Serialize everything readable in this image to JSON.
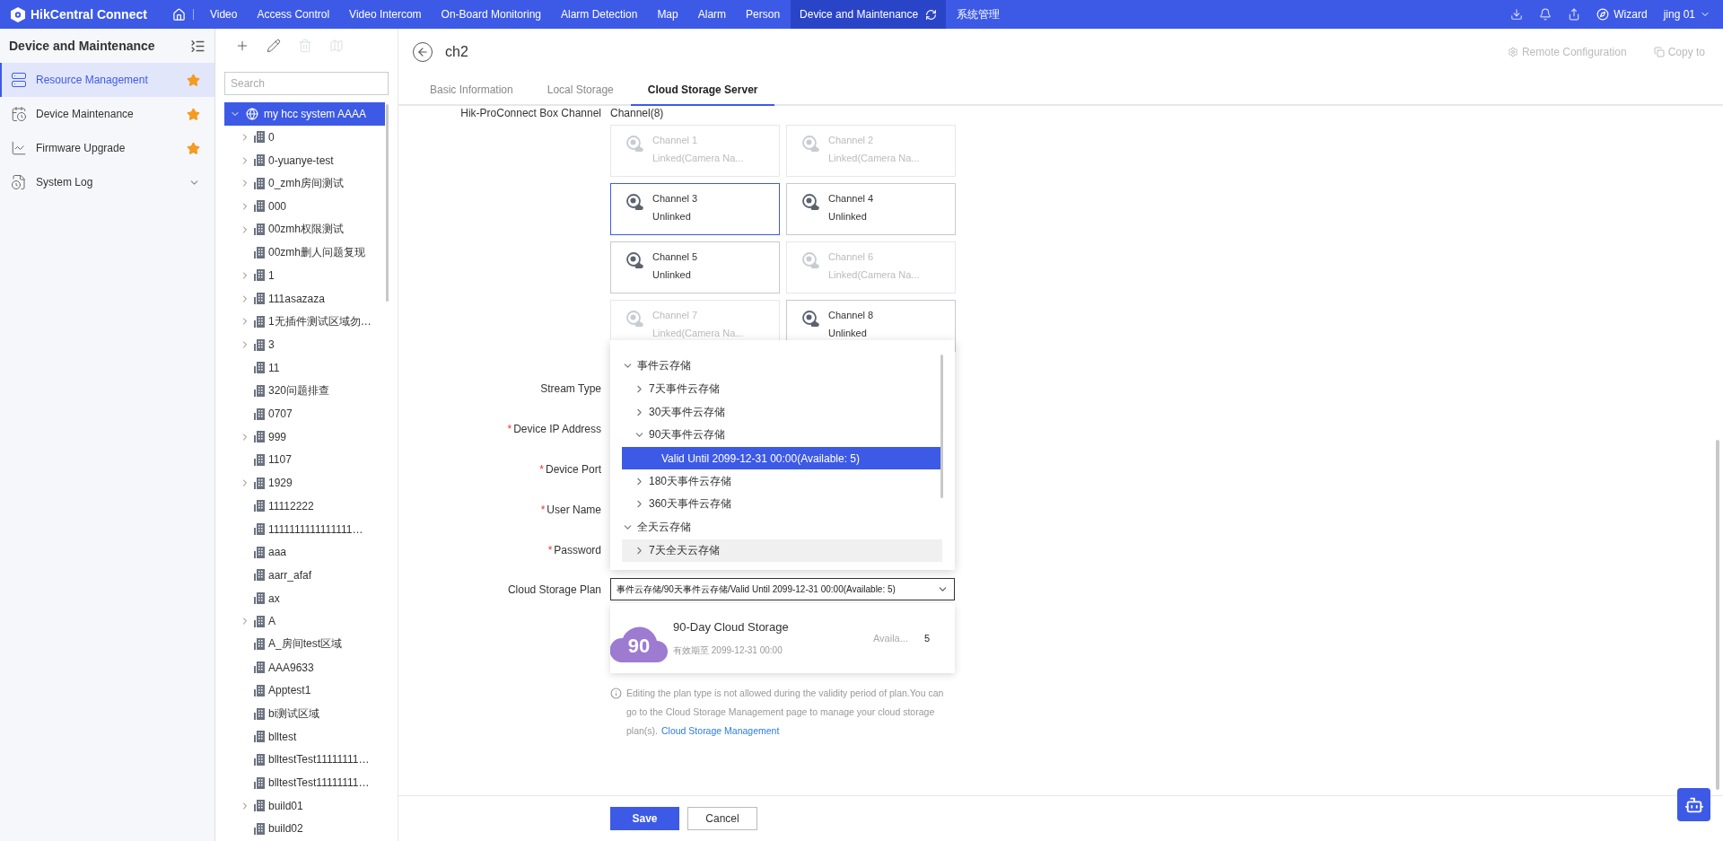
{
  "app": {
    "title": "HikCentral Connect"
  },
  "nav": [
    {
      "label": "Video",
      "selected": false
    },
    {
      "label": "Access Control",
      "selected": false
    },
    {
      "label": "Video Intercom",
      "selected": false
    },
    {
      "label": "On-Board Monitoring",
      "selected": false
    },
    {
      "label": "Alarm Detection",
      "selected": false
    },
    {
      "label": "Map",
      "selected": false
    },
    {
      "label": "Alarm",
      "selected": false
    },
    {
      "label": "Person",
      "selected": false
    },
    {
      "label": "Device and Maintenance",
      "selected": true
    },
    {
      "label": "系统管理",
      "selected": false
    }
  ],
  "user": {
    "wizard": "Wizard",
    "name": "jing 01"
  },
  "sidebar": {
    "title": "Device and Maintenance",
    "items": [
      {
        "label": "Resource Management",
        "selected": true,
        "kind": "favorite"
      },
      {
        "label": "Device Maintenance",
        "selected": false,
        "kind": "favorite"
      },
      {
        "label": "Firmware Upgrade",
        "selected": false,
        "kind": "favorite"
      },
      {
        "label": "System Log",
        "selected": false,
        "kind": "group"
      }
    ]
  },
  "tree": {
    "tools": [
      {
        "kind": "add",
        "disabled": false
      },
      {
        "kind": "edit",
        "disabled": false
      },
      {
        "kind": "delete",
        "disabled": true
      },
      {
        "kind": "map",
        "disabled": true
      }
    ],
    "search": {
      "placeholder": "Search"
    },
    "root": {
      "label": "my hcc system AAAA",
      "selected": true,
      "expanded": true
    },
    "children": [
      {
        "label": "0",
        "expandable": true
      },
      {
        "label": "0-yuanye-test",
        "expandable": true
      },
      {
        "label": "0_zmh房间测试",
        "expandable": true
      },
      {
        "label": "000",
        "expandable": true
      },
      {
        "label": "00zmh权限测试",
        "expandable": true
      },
      {
        "label": "00zmh删人问题复现",
        "expandable": false
      },
      {
        "label": "1",
        "expandable": true
      },
      {
        "label": "111asazaza",
        "expandable": true
      },
      {
        "label": "1无插件测试区域勿…",
        "expandable": true
      },
      {
        "label": "3",
        "expandable": true
      },
      {
        "label": "11",
        "expandable": false
      },
      {
        "label": "320问题排查",
        "expandable": false
      },
      {
        "label": "0707",
        "expandable": false
      },
      {
        "label": "999",
        "expandable": true
      },
      {
        "label": "1107",
        "expandable": false
      },
      {
        "label": "1929",
        "expandable": true
      },
      {
        "label": "11112222",
        "expandable": false
      },
      {
        "label": "1111111111111111…",
        "expandable": false
      },
      {
        "label": "aaa",
        "expandable": false
      },
      {
        "label": "aarr_afaf",
        "expandable": false
      },
      {
        "label": "ax",
        "expandable": false
      },
      {
        "label": "A",
        "expandable": true
      },
      {
        "label": "A_房间test区域",
        "expandable": false
      },
      {
        "label": "AAA9633",
        "expandable": false
      },
      {
        "label": "Apptest1",
        "expandable": false
      },
      {
        "label": "bi测试区域",
        "expandable": false
      },
      {
        "label": "blltest",
        "expandable": false
      },
      {
        "label": "blltestTest11111111…",
        "expandable": false
      },
      {
        "label": "blltestTest11111111…",
        "expandable": false
      },
      {
        "label": "build01",
        "expandable": true
      },
      {
        "label": "build02",
        "expandable": false
      }
    ]
  },
  "detail": {
    "title": "ch2",
    "actions": [
      {
        "label": "Remote Configuration",
        "kind": "settings",
        "disabled": true
      },
      {
        "label": "Copy to",
        "kind": "copy",
        "disabled": true
      }
    ],
    "tabs": [
      {
        "label": "Basic Information",
        "selected": false
      },
      {
        "label": "Local Storage",
        "selected": false
      },
      {
        "label": "Cloud Storage Server",
        "selected": true
      }
    ],
    "channel_label": "Hik-ProConnect Box Channel",
    "channel_count": "Channel(8)",
    "channels": [
      {
        "name": "Channel 1",
        "status": "Linked(Camera Na...",
        "disabled": true,
        "selected": false
      },
      {
        "name": "Channel 2",
        "status": "Linked(Camera Na...",
        "disabled": true,
        "selected": false
      },
      {
        "name": "Channel 3",
        "status": "Unlinked",
        "disabled": false,
        "selected": true
      },
      {
        "name": "Channel 4",
        "status": "Unlinked",
        "disabled": false,
        "selected": false
      },
      {
        "name": "Channel 5",
        "status": "Unlinked",
        "disabled": false,
        "selected": false
      },
      {
        "name": "Channel 6",
        "status": "Linked(Camera Na...",
        "disabled": true,
        "selected": false
      },
      {
        "name": "Channel 7",
        "status": "Linked(Camera Na...",
        "disabled": true,
        "selected": false
      },
      {
        "name": "Channel 8",
        "status": "Unlinked",
        "disabled": false,
        "selected": false
      }
    ],
    "fields": [
      {
        "label": "Stream Type"
      },
      {
        "label": "Device IP Address",
        "mark": "*"
      },
      {
        "label": "Device Port",
        "mark": "*"
      },
      {
        "label": "User Name",
        "mark": "*"
      },
      {
        "label": "Password",
        "mark": "*"
      }
    ],
    "plan": {
      "label": "Cloud Storage Plan",
      "value": "事件云存储/90天事件云存储/Valid Until  2099-12-31 00:00(Available: 5)",
      "menu": [
        {
          "label": "事件云存储",
          "expanded": true,
          "selected": false,
          "hovered": false,
          "children": [
            {
              "label": "7天事件云存储",
              "expanded": false,
              "selected": false,
              "hovered": false
            },
            {
              "label": "30天事件云存储",
              "expanded": false,
              "selected": false,
              "hovered": false
            },
            {
              "label": "90天事件云存储",
              "expanded": true,
              "selected": false,
              "hovered": false,
              "children": [
                {
                  "label": "Valid Until 2099-12-31 00:00(Available: 5)",
                  "selected": true
                }
              ]
            },
            {
              "label": "180天事件云存储",
              "expanded": false,
              "selected": false,
              "hovered": false
            },
            {
              "label": "360天事件云存储",
              "expanded": false,
              "selected": false,
              "hovered": false
            }
          ]
        },
        {
          "label": "全天云存储",
          "expanded": true,
          "selected": false,
          "hovered": false,
          "children": [
            {
              "label": "7天全天云存储",
              "expanded": false,
              "selected": false,
              "hovered": true
            }
          ]
        }
      ],
      "card": {
        "badge": "90",
        "title": "90-Day Cloud Storage",
        "validity": "有效期至 2099-12-31 00:00",
        "available_label": "Availa...",
        "available": "5"
      },
      "hint": "Editing the plan type is not allowed during the validity period of plan.You can go to the Cloud Storage Management page to manage your cloud storage plan(s).",
      "hint_link": "Cloud Storage Management"
    }
  },
  "buttons": [
    {
      "label": "Save",
      "kind": "primary"
    },
    {
      "label": "Cancel",
      "kind": "secondary"
    }
  ]
}
